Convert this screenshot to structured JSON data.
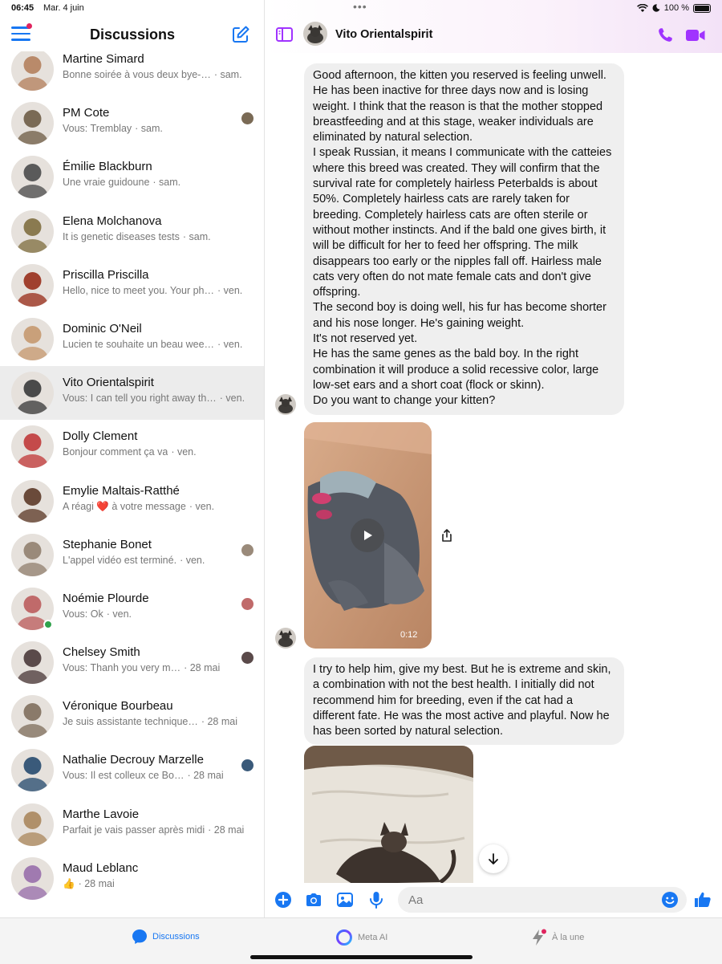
{
  "status_bar": {
    "time": "06:45",
    "date": "Mar. 4 juin",
    "battery": "100 %"
  },
  "sidebar": {
    "title": "Discussions",
    "conversations": [
      {
        "name": "Martine Simard",
        "preview": "Bonne soirée à vous deux bye-…",
        "time": "· sam.",
        "avatar_color": "#b98a6a",
        "seen": false
      },
      {
        "name": "PM Cote",
        "preview": "Vous: Tremblay",
        "time": "· sam.",
        "avatar_color": "#7a6a55",
        "seen": true
      },
      {
        "name": "Émilie Blackburn",
        "preview": "Une vraie guidoune",
        "time": "· sam.",
        "avatar_color": "#5a5a5a",
        "seen": false
      },
      {
        "name": "Elena Molchanova",
        "preview": "It is genetic diseases tests",
        "time": "· sam.",
        "avatar_color": "#8a7a50",
        "seen": false
      },
      {
        "name": "Priscilla Priscilla",
        "preview": "Hello, nice to meet you. Your ph…",
        "time": "· ven.",
        "avatar_color": "#a0402e",
        "seen": false
      },
      {
        "name": "Dominic O'Neil",
        "preview": "Lucien te souhaite un beau wee…",
        "time": "· ven.",
        "avatar_color": "#c9a07a",
        "seen": false
      },
      {
        "name": "Vito Orientalspirit",
        "preview": "Vous: I can tell you right away th…",
        "time": "· ven.",
        "avatar_color": "#4a4a4a",
        "seen": false
      },
      {
        "name": "Dolly Clement",
        "preview": "Bonjour comment ça va",
        "time": "· ven.",
        "avatar_color": "#c44a4a",
        "seen": false
      },
      {
        "name": "Emylie Maltais-Ratthé",
        "preview": "A réagi ❤️ à votre message",
        "time": "· ven.",
        "avatar_color": "#6a4a3a",
        "seen": false
      },
      {
        "name": "Stephanie Bonet",
        "preview": "L'appel vidéo est terminé.",
        "time": "· ven.",
        "avatar_color": "#9a8a7a",
        "seen": true
      },
      {
        "name": "Noémie Plourde",
        "preview": "Vous: Ok",
        "time": "· ven.",
        "avatar_color": "#c06a6a",
        "seen": true,
        "online": true
      },
      {
        "name": "Chelsey Smith",
        "preview": "Vous: Thanh you very m…",
        "time": "· 28 mai",
        "avatar_color": "#5a4a4a",
        "seen": true
      },
      {
        "name": "Véronique Bourbeau",
        "preview": "Je suis assistante technique…",
        "time": "· 28 mai",
        "avatar_color": "#8a7a6a",
        "seen": false
      },
      {
        "name": "Nathalie Decrouy Marzelle",
        "preview": "Vous: Il est colleux ce Bo…",
        "time": "· 28 mai",
        "avatar_color": "#3a5a7a",
        "seen": true
      },
      {
        "name": "Marthe Lavoie",
        "preview": "Parfait je vais passer après midi",
        "time": "· 28 mai",
        "avatar_color": "#b0906a",
        "seen": false
      },
      {
        "name": "Maud Leblanc",
        "preview": "👍",
        "time": "· 28 mai",
        "avatar_color": "#a07ab0",
        "seen": false
      }
    ]
  },
  "chat": {
    "contact_name": "Vito Orientalspirit",
    "message1": "Good afternoon, the kitten you reserved is feeling unwell. He has been inactive for three days now and is losing weight. I think that the reason is that the mother stopped breastfeeding and at this stage, weaker individuals are eliminated by natural selection.\nI speak Russian, it means I communicate with the catteies where this breed was created. They will confirm that the survival rate for completely hairless Peterbalds is about 50%. Completely hairless cats are rarely taken for breeding. Completely hairless cats are often sterile or without mother instincts. And if the bald one gives birth, it will be difficult for her to feed her offspring. The milk disappears too early or the nipples fall off. Hairless male cats very often do not mate female cats and don't give offspring.\nThe second boy is doing well, his fur has become shorter and his nose longer. He's gaining weight.\nIt's not reserved yet.\nHe has the same genes as the bald boy. In the right combination it will produce a solid recessive color, large low-set ears and a short coat (flock or skinn).\nDo you want to change your kitten?",
    "video_duration": "0:12",
    "message2": "I try to help him, give my best.  But he is extreme and skin, a combination with not the best health. I initially did not recommend him for breeding, even if the cat had a different fate. He was the most active and playful. Now he has been sorted by natural selection."
  },
  "composer": {
    "placeholder": "Aa"
  },
  "tabbar": {
    "discussions": "Discussions",
    "meta_ai": "Meta AI",
    "a_la_une": "À la une"
  },
  "colors": {
    "accent": "#1877f2",
    "call_purple": "#a033ff",
    "online_green": "#31a24c"
  }
}
